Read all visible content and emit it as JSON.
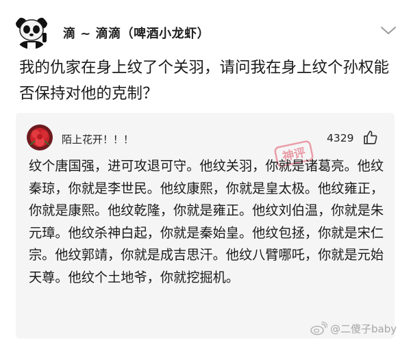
{
  "post": {
    "author": "滴 ~ 滴滴（啤酒小龙虾）",
    "question": "我的仇家在身上纹了个关羽，请问我在身上纹个孙权能否保持对他的克制？"
  },
  "comment": {
    "username": "陌上花开！！！",
    "likes": "4329",
    "stamp_text": "神评",
    "text": "纹个唐国强，进可攻退可守。他纹关羽，你就是诸葛亮。他纹秦琼，你就是李世民。他纹康熙，你就是皇太极。他纹雍正，你就是康熙。他纹乾隆，你就是雍正。他纹刘伯温，你就是朱元璋。他纹杀神白起，你就是秦始皇。他纹包拯，你就是宋仁宗。他纹郭靖，你就是成吉思汗。他纹八臂哪吒，你就是元始天尊。他纹个土地爷，你就挖掘机。"
  },
  "watermark": {
    "text": "@二傻子baby"
  },
  "colors": {
    "card_bg": "#f5f5f5",
    "stamp": "#e0566a",
    "watermark": "#a5a5a5"
  },
  "icons": {
    "author_avatar": "panda-meme-avatar",
    "more": "chevron-down-icon",
    "like": "thumbs-up-icon",
    "comment_avatar": "red-flower-avatar",
    "watermark_logo": "weibo-logo"
  }
}
